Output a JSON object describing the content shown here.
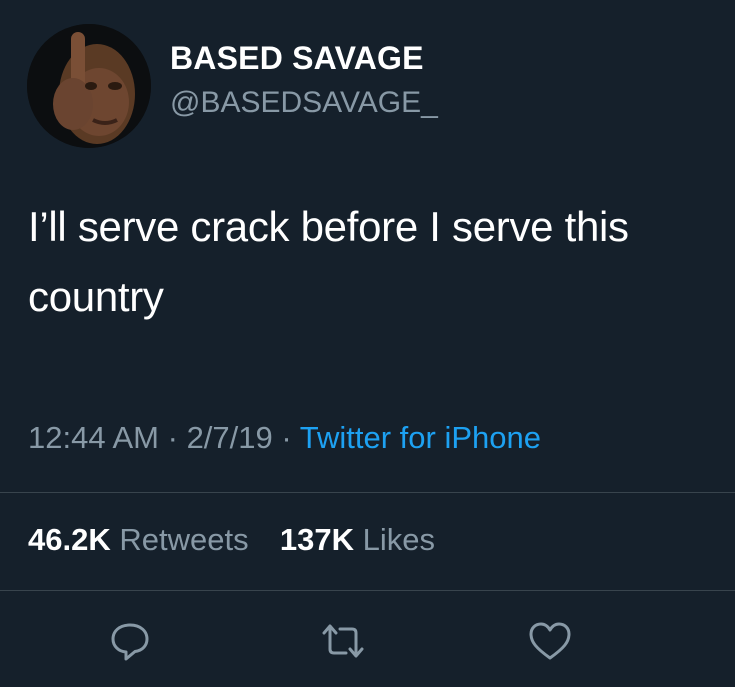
{
  "user": {
    "display_name": "BASED SAVAGE",
    "handle": "@BASEDSAVAGE_",
    "avatar_icon": "profile-photo"
  },
  "tweet": {
    "text": "I’ll serve crack before I serve this country",
    "time": "12:44 AM",
    "date": "2/7/19",
    "separator": "·",
    "source": "Twitter for iPhone"
  },
  "stats": {
    "retweets_count": "46.2K",
    "retweets_label": "Retweets",
    "likes_count": "137K",
    "likes_label": "Likes"
  },
  "actions": [
    {
      "icon": "reply-icon"
    },
    {
      "icon": "retweet-icon"
    },
    {
      "icon": "like-icon"
    }
  ],
  "colors": {
    "background": "#15202b",
    "secondary_text": "#8899a6",
    "link": "#1da1f2",
    "divider": "#38444d"
  }
}
